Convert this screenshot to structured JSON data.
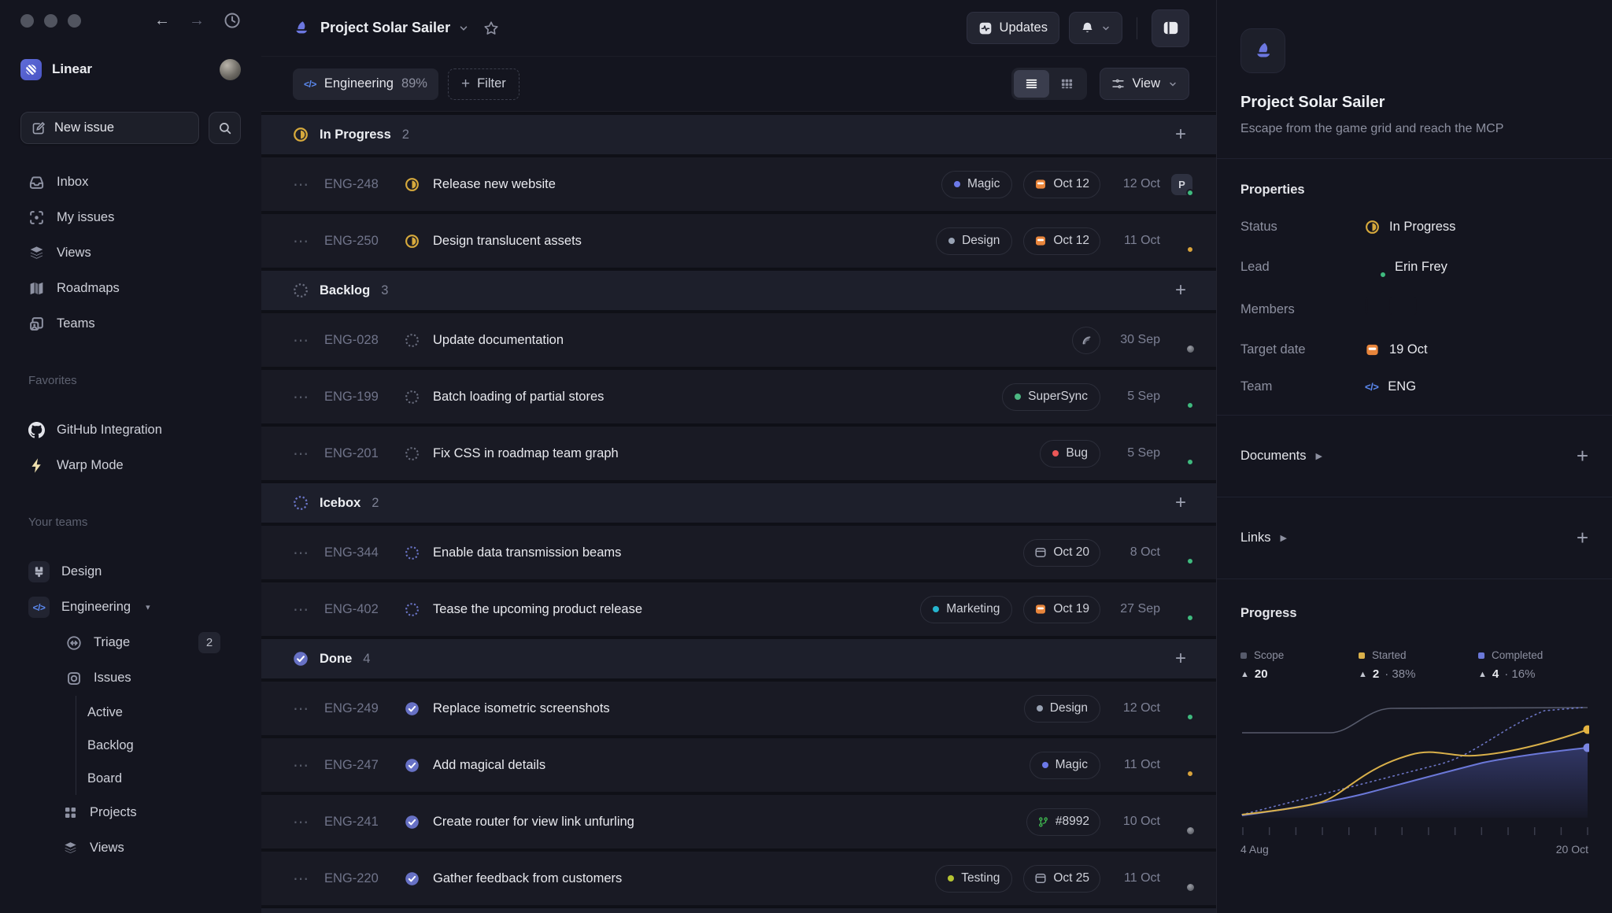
{
  "colors": {
    "accent_indigo": "#5e6ad2",
    "in_progress_yellow": "#d6a93c",
    "done_indigo": "#6771c5",
    "backlog_gray": "#696d7e",
    "icebox_indigo": "#6b76c9",
    "overdue_orange": "#e8853b",
    "online_green": "#3fba7e",
    "away_yellow": "#d9a33b",
    "team_code_blue": "#5c8af2",
    "github_branch_green": "#3fb950",
    "label_magic": "#6c79e8",
    "label_design": "#98a2b3",
    "label_supersync": "#4cb782",
    "label_bug": "#eb5757",
    "label_marketing": "#26b5ce",
    "label_testing": "#b5c332",
    "scope_line_gray": "#565a6b",
    "started_line_yellow": "#d9b04a",
    "completed_line_indigo": "#6b78d8"
  },
  "sidebar": {
    "workspace_name": "Linear",
    "new_issue_label": "New issue",
    "nav": [
      {
        "label": "Inbox"
      },
      {
        "label": "My issues"
      },
      {
        "label": "Views"
      },
      {
        "label": "Roadmaps"
      },
      {
        "label": "Teams"
      }
    ],
    "favorites_title": "Favorites",
    "favorites": [
      {
        "label": "GitHub Integration"
      },
      {
        "label": "Warp Mode"
      }
    ],
    "your_teams_title": "Your teams",
    "team_design": "Design",
    "team_engineering": "Engineering",
    "triage_label": "Triage",
    "triage_badge": "2",
    "issues_label": "Issues",
    "issues_children": [
      "Active",
      "Backlog",
      "Board"
    ],
    "projects_label": "Projects",
    "views_label": "Views"
  },
  "header": {
    "title": "Project Solar Sailer",
    "updates_label": "Updates"
  },
  "toolbar": {
    "team_chip_label": "Engineering",
    "team_chip_percent": "89%",
    "filter_label": "Filter",
    "view_label": "View"
  },
  "list": {
    "sections": [
      {
        "title": "In Progress",
        "count": "2",
        "rows": [
          {
            "id": "ENG-248",
            "title": "Release new website",
            "label": "Magic",
            "label_color": "#6c79e8",
            "due": "Oct 12",
            "date": "12 Oct",
            "avatar_letter": "P"
          },
          {
            "id": "ENG-250",
            "title": "Design translucent assets",
            "label": "Design",
            "label_color": "#98a2b3",
            "due": "Oct 12",
            "date": "11 Oct"
          }
        ]
      },
      {
        "title": "Backlog",
        "count": "3",
        "rows": [
          {
            "id": "ENG-028",
            "title": "Update documentation",
            "date": "30 Sep"
          },
          {
            "id": "ENG-199",
            "title": "Batch loading of partial stores",
            "label": "SuperSync",
            "label_color": "#4cb782",
            "date": "5 Sep"
          },
          {
            "id": "ENG-201",
            "title": "Fix CSS in roadmap team graph",
            "label": "Bug",
            "label_color": "#eb5757",
            "date": "5 Sep"
          }
        ]
      },
      {
        "title": "Icebox",
        "count": "2",
        "rows": [
          {
            "id": "ENG-344",
            "title": "Enable data transmission beams",
            "due": "Oct 20",
            "date": "8 Oct"
          },
          {
            "id": "ENG-402",
            "title": "Tease the upcoming product release",
            "label": "Marketing",
            "label_color": "#26b5ce",
            "due": "Oct 19",
            "date": "27 Sep"
          }
        ]
      },
      {
        "title": "Done",
        "count": "4",
        "rows": [
          {
            "id": "ENG-249",
            "title": "Replace isometric screenshots",
            "label": "Design",
            "label_color": "#98a2b3",
            "date": "12 Oct"
          },
          {
            "id": "ENG-247",
            "title": "Add magical details",
            "label": "Magic",
            "label_color": "#6c79e8",
            "date": "11 Oct"
          },
          {
            "id": "ENG-241",
            "title": "Create router for view link unfurling",
            "pr": "#8992",
            "date": "10 Oct"
          },
          {
            "id": "ENG-220",
            "title": "Gather feedback from customers",
            "label": "Testing",
            "label_color": "#b5c332",
            "due": "Oct 25",
            "date": "11 Oct"
          }
        ]
      }
    ]
  },
  "panel": {
    "title": "Project Solar Sailer",
    "description": "Escape from the game grid and reach the MCP",
    "properties_title": "Properties",
    "status_label": "Status",
    "status_value": "In Progress",
    "lead_label": "Lead",
    "lead_value": "Erin Frey",
    "members_label": "Members",
    "target_label": "Target date",
    "target_value": "19 Oct",
    "team_label": "Team",
    "team_value": "ENG",
    "documents_title": "Documents",
    "links_title": "Links",
    "progress_title": "Progress"
  },
  "chart_data": {
    "type": "area",
    "title": "Progress",
    "legend": [
      {
        "name": "Scope",
        "value": "20",
        "extra": ""
      },
      {
        "name": "Started",
        "value": "2",
        "extra": "· 38%"
      },
      {
        "name": "Completed",
        "value": "4",
        "extra": "· 16%"
      }
    ],
    "x_axis": {
      "start": "4 Aug",
      "end": "20 Oct"
    },
    "series": [
      {
        "name": "Scope",
        "style": "solid-gray",
        "points_pct": [
          [
            0,
            68
          ],
          [
            26,
            68
          ],
          [
            38,
            92
          ],
          [
            100,
            93
          ]
        ]
      },
      {
        "name": "Started",
        "style": "solid-yellow",
        "points_pct": [
          [
            0,
            2
          ],
          [
            23,
            12
          ],
          [
            40,
            52
          ],
          [
            48,
            57
          ],
          [
            62,
            55
          ],
          [
            80,
            64
          ],
          [
            100,
            76
          ]
        ]
      },
      {
        "name": "Completed",
        "style": "area-indigo",
        "points_pct": [
          [
            0,
            2
          ],
          [
            30,
            18
          ],
          [
            55,
            42
          ],
          [
            75,
            55
          ],
          [
            100,
            62
          ]
        ]
      },
      {
        "name": "Projected",
        "style": "dotted-indigo",
        "points_pct": [
          [
            0,
            2
          ],
          [
            57,
            45
          ],
          [
            78,
            73
          ],
          [
            90,
            90
          ],
          [
            100,
            93
          ]
        ]
      }
    ]
  }
}
